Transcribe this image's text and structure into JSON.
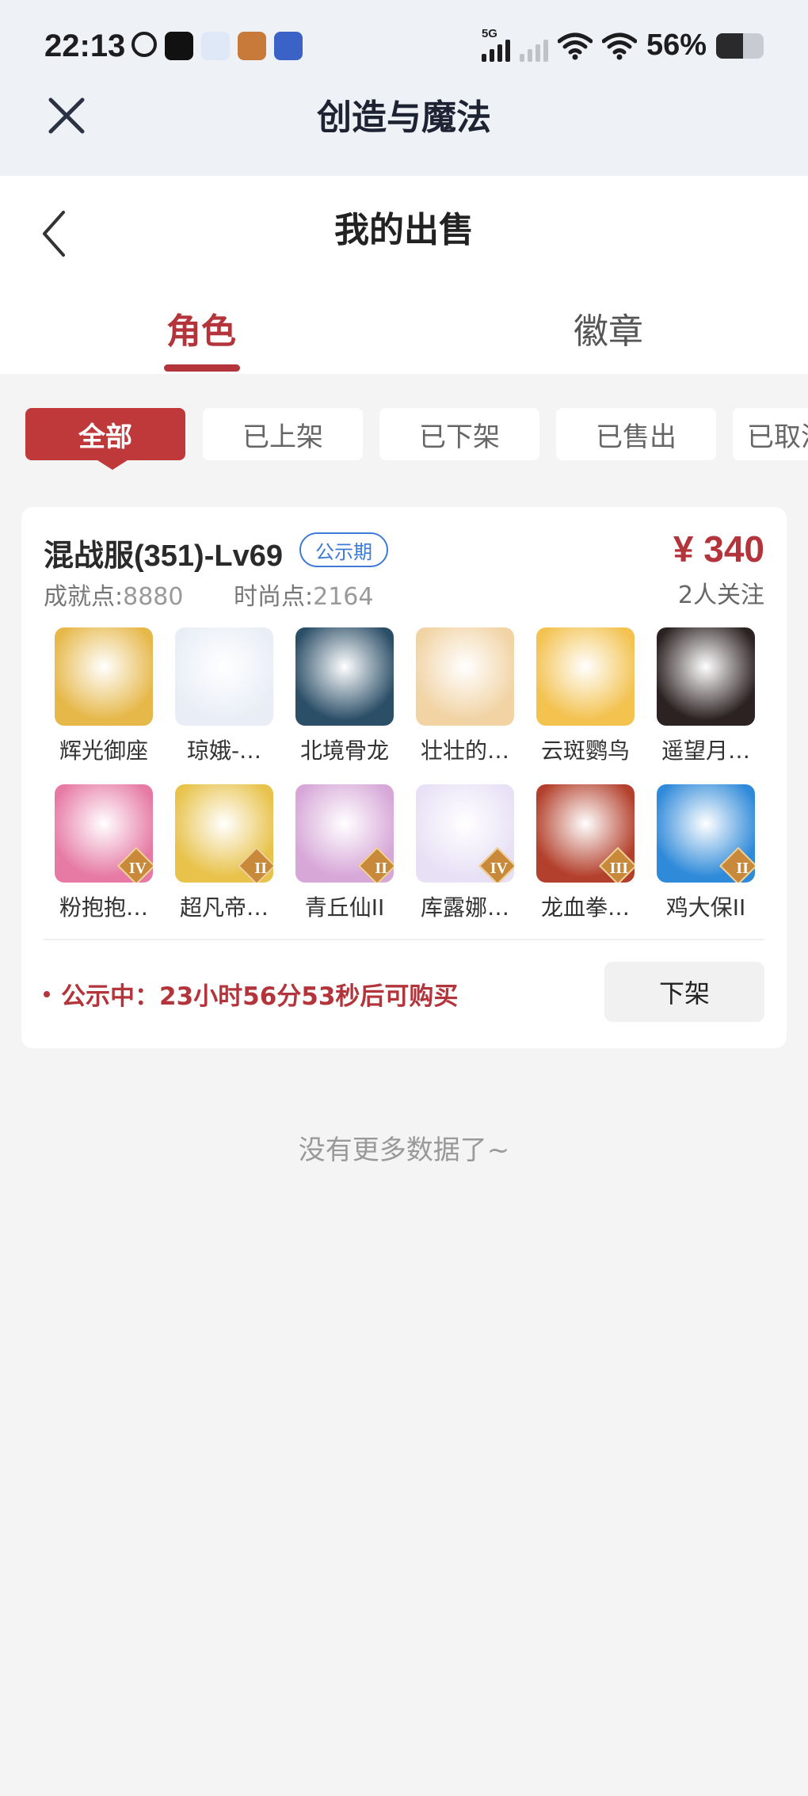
{
  "status_bar": {
    "time": "22:13",
    "network_tag": "5G",
    "battery": "56%",
    "battery_level": 0.56
  },
  "app_bar": {
    "title": "创造与魔法"
  },
  "page": {
    "title": "我的出售"
  },
  "tabs": [
    {
      "label": "角色",
      "active": true
    },
    {
      "label": "徽章",
      "active": false
    }
  ],
  "filters": [
    {
      "label": "全部",
      "active": true
    },
    {
      "label": "已上架",
      "active": false
    },
    {
      "label": "已下架",
      "active": false
    },
    {
      "label": "已售出",
      "active": false
    },
    {
      "label": "已取消",
      "active": false
    }
  ],
  "listing": {
    "server": "混战服(351)-Lv69",
    "status_badge": "公示期",
    "price": "¥ 340",
    "watchers": "2人关注",
    "achievement_label": "成就点:",
    "achievement_value": "8880",
    "fashion_label": "时尚点:",
    "fashion_value": "2164",
    "items": [
      {
        "name": "辉光御座",
        "icon": "throne-icon",
        "color": "#e6b84a"
      },
      {
        "name": "琼娥-…",
        "icon": "moon-fairy-icon",
        "color": "#e9eef6"
      },
      {
        "name": "北境骨龙",
        "icon": "bone-dragon-icon",
        "color": "#2c4f68"
      },
      {
        "name": "壮壮的…",
        "icon": "cat-icon",
        "color": "#f1d3a4"
      },
      {
        "name": "云斑鹦鸟",
        "icon": "parrot-icon",
        "color": "#f3c24f"
      },
      {
        "name": "遥望月…",
        "icon": "pig-icon",
        "color": "#2c2222"
      },
      {
        "name": "粉抱抱…",
        "icon": "pink-bear-icon",
        "color": "#e67aa4",
        "rank": "IV"
      },
      {
        "name": "超凡帝…",
        "icon": "golden-armor-icon",
        "color": "#e8c24a",
        "rank": "II"
      },
      {
        "name": "青丘仙II",
        "icon": "fox-fairy-icon",
        "color": "#d7a7d8",
        "rank": "II"
      },
      {
        "name": "库露娜…",
        "icon": "white-hair-girl-icon",
        "color": "#e8e1f6",
        "rank": "IV"
      },
      {
        "name": "龙血拳…",
        "icon": "red-beast-icon",
        "color": "#b3402c",
        "rank": "III"
      },
      {
        "name": "鸡大保II",
        "icon": "blue-chick-icon",
        "color": "#2f8ad9",
        "rank": "II"
      }
    ],
    "notice": "公示中：23小时56分53秒后可购买",
    "action_label": "下架"
  },
  "footer": {
    "no_more": "没有更多数据了~"
  },
  "colors": {
    "accent": "#b3343a",
    "badge_blue": "#3d7ad6"
  }
}
